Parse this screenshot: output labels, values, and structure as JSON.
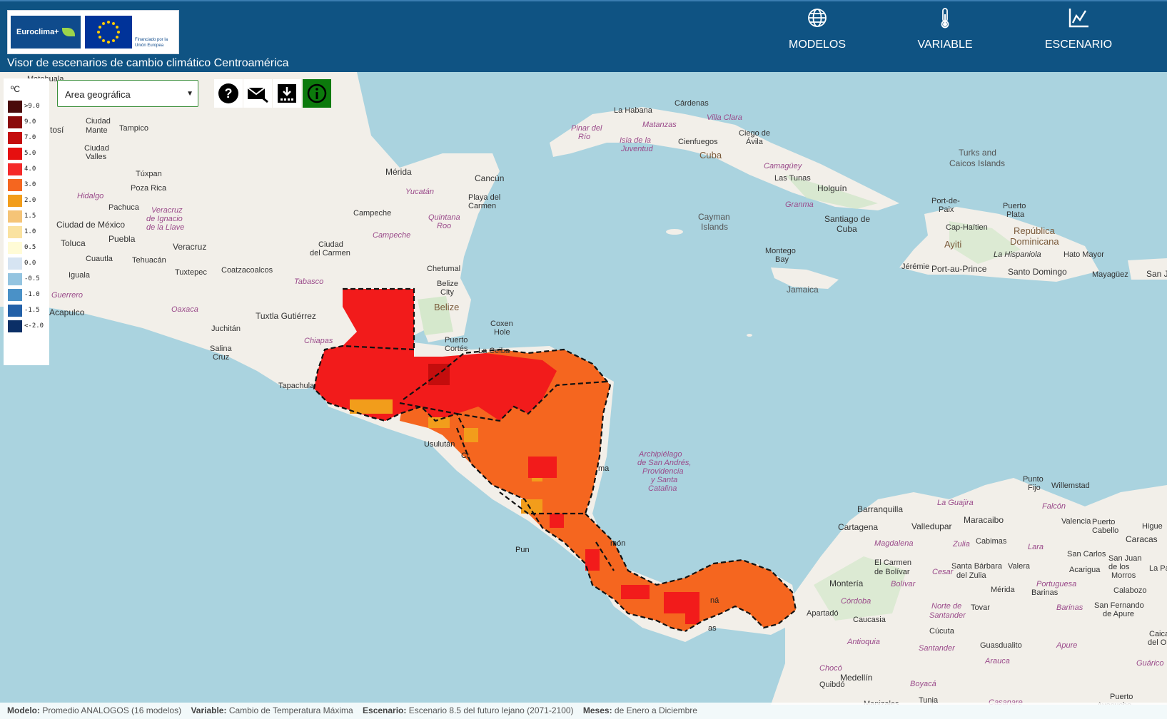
{
  "header": {
    "logo_brand": "Euroclima+",
    "logo_funding": "Financiado por la Unión Europea",
    "title": "Visor de escenarios de cambio climático Centroamérica",
    "nav": [
      {
        "label": "MODELOS",
        "icon": "globe-icon"
      },
      {
        "label": "VARIABLE",
        "icon": "thermometer-icon"
      },
      {
        "label": "ESCENARIO",
        "icon": "line-chart-icon"
      }
    ]
  },
  "legend": {
    "unit": "ºC",
    "items": [
      {
        "label": ">9.0",
        "color": "#4a0b0b"
      },
      {
        "label": "9.0",
        "color": "#8b0a0a"
      },
      {
        "label": "7.0",
        "color": "#c40d0d"
      },
      {
        "label": "5.0",
        "color": "#e60f0f"
      },
      {
        "label": "4.0",
        "color": "#f52a2a"
      },
      {
        "label": "3.0",
        "color": "#f5661f"
      },
      {
        "label": "2.0",
        "color": "#f29d1b"
      },
      {
        "label": "1.5",
        "color": "#f5c477"
      },
      {
        "label": "1.0",
        "color": "#fae2a0"
      },
      {
        "label": "0.5",
        "color": "#fffbd6"
      },
      {
        "label": "0.0",
        "color": "#d6e4f2"
      },
      {
        "label": "-0.5",
        "color": "#94c4e0"
      },
      {
        "label": "-1.0",
        "color": "#4a91c7"
      },
      {
        "label": "-1.5",
        "color": "#2361a8"
      },
      {
        "label": "<-2.0",
        "color": "#0b2f66"
      }
    ]
  },
  "toolbar": {
    "geo_select_value": "Area geográfica",
    "buttons": [
      "help-icon",
      "email-icon",
      "download-icon",
      "info-icon"
    ]
  },
  "map": {
    "colors": {
      "sea": "#aad3df",
      "land": "#f2efe9",
      "hot": "#f21b1b",
      "warm": "#f5661f",
      "border": "#111111"
    },
    "places": [
      "La Habana",
      "Cárdenas",
      "Villa Clara",
      "Matanzas",
      "Cienfuegos",
      "Cuba",
      "Ciego de Ávila",
      "Camagüey",
      "Las Tunas",
      "Holguín",
      "Granma",
      "Santiago de Cuba",
      "Pinar del Río",
      "Isla de la Juventud",
      "Turks and Caicos Islands",
      "Port-de-Paix",
      "Puerto Plata",
      "Cap-Haïtien",
      "República Dominicana",
      "La Hispaniola",
      "Ayiti",
      "Jérémie",
      "Port-au-Prince",
      "Santo Domingo",
      "Hato Mayor",
      "Mayagüez",
      "San J",
      "Cayman Islands",
      "Montego Bay",
      "Jamaica",
      "Mérida",
      "Cancún",
      "Yucatán",
      "Playa del Carmen",
      "Campeche",
      "Quintana Roo",
      "Ciudad del Carmen",
      "Chetumal",
      "Belize City",
      "Belize",
      "Tabasco",
      "Coatzacoalcos",
      "Tuxtla Gutiérrez",
      "Chiapas",
      "Tapachula",
      "Coxen Hole",
      "Puerto Cortés",
      "La Ceiba",
      "Ciudad Mante",
      "Tampico",
      "Ciudad Valles",
      "Túxpan",
      "Poza Rica",
      "Hidalgo",
      "Pachuca",
      "Veracruz de Ignacio de la Llave",
      "Ciudad de México",
      "Puebla",
      "Toluca",
      "Veracruz",
      "Tehuacán",
      "Cuautla",
      "Iguala",
      "Tuxtepec",
      "Guerrero",
      "Oaxaca",
      "Acapulco",
      "Juchitán",
      "Salina Cruz",
      "Matehuala",
      "tosí",
      "Archipiélago de San Andrés, Providencia y Santa Catalina",
      "Barranquilla",
      "Cartagena",
      "Valledupar",
      "Maracaibo",
      "La Guajira",
      "Punto Fijo",
      "Willemstad",
      "Falcón",
      "Zulia",
      "Cabimas",
      "Magdalena",
      "El Carmen de Bolívar",
      "Cesar",
      "Santa Bárbara del Zulia",
      "Valera",
      "Montería",
      "Córdoba",
      "Bolívar",
      "Norte de Santander",
      "Caucasia",
      "Antioquia",
      "Cúcuta",
      "Mérida",
      "Barinas",
      "Tovar",
      "Guasdualito",
      "Santander",
      "Apure",
      "Arauca",
      "Medellín",
      "Quibdó",
      "Chocó",
      "Boyacá",
      "Tunja",
      "Casanare",
      "Apartadó",
      "Valencia",
      "Caracas",
      "Puerto Cabello",
      "Lara",
      "Portuguesa",
      "San Carlos",
      "Acarigua",
      "San Juan de los Morros",
      "Calabozo",
      "San Fernando de Apure",
      "Puerto Ayacucho",
      "Manizales",
      "Higue",
      "La Pa",
      "Caica",
      "del Ori",
      "Guárico"
    ]
  },
  "status": {
    "model_label": "Modelo:",
    "model_value": "Promedio ANALOGOS (16 modelos)",
    "variable_label": "Variable:",
    "variable_value": "Cambio de Temperatura Máxima",
    "scenario_label": "Escenario:",
    "scenario_value": "Escenario 8.5 del futuro lejano (2071-2100)",
    "months_label": "Meses:",
    "months_value": "de Enero a Diciembre"
  }
}
